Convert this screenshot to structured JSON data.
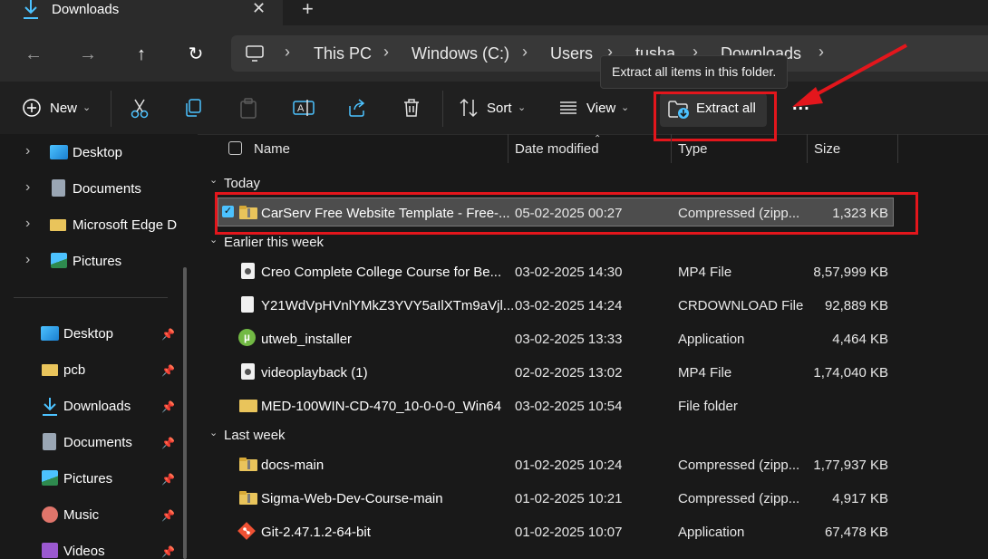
{
  "tab": {
    "title": "Downloads",
    "close_icon": "close-icon",
    "add_icon": "plus-icon"
  },
  "nav": {
    "breadcrumbs": [
      "This PC",
      "Windows (C:)",
      "Users",
      "tusha",
      "Downloads"
    ],
    "tooltip": "Extract all items in this folder."
  },
  "toolbar": {
    "new_label": "New",
    "sort_label": "Sort",
    "view_label": "View",
    "extract_label": "Extract all",
    "more_label": "..."
  },
  "sidebar": {
    "tree": [
      "Desktop",
      "Documents",
      "Microsoft Edge D",
      "Pictures"
    ],
    "quick": [
      "Desktop",
      "pcb",
      "Downloads",
      "Documents",
      "Pictures",
      "Music",
      "Videos"
    ]
  },
  "columns": {
    "name": "Name",
    "date": "Date modified",
    "type": "Type",
    "size": "Size"
  },
  "groups": [
    {
      "label": "Today",
      "rows": [
        {
          "name": "CarServ Free Website Template - Free-...",
          "date": "05-02-2025 00:27",
          "type": "Compressed (zipp...",
          "size": "1,323 KB",
          "icon": "zip-folder-icon"
        }
      ]
    },
    {
      "label": "Earlier this week",
      "rows": [
        {
          "name": "Creo Complete College Course for Be...",
          "date": "03-02-2025 14:30",
          "type": "MP4 File",
          "size": "8,57,999 KB",
          "icon": "video-file-icon"
        },
        {
          "name": "Y21WdVpHVnlYMkZ3YVY5aIlXTm9aVjl...",
          "date": "03-02-2025 14:24",
          "type": "CRDOWNLOAD File",
          "size": "92,889 KB",
          "icon": "file-icon"
        },
        {
          "name": "utweb_installer",
          "date": "03-02-2025 13:33",
          "type": "Application",
          "size": "4,464 KB",
          "icon": "utorrent-icon"
        },
        {
          "name": "videoplayback (1)",
          "date": "02-02-2025 13:02",
          "type": "MP4 File",
          "size": "1,74,040 KB",
          "icon": "video-file-icon"
        },
        {
          "name": "MED-100WIN-CD-470_10-0-0-0_Win64",
          "date": "03-02-2025 10:54",
          "type": "File folder",
          "size": "",
          "icon": "folder-icon"
        }
      ]
    },
    {
      "label": "Last week",
      "rows": [
        {
          "name": "docs-main",
          "date": "01-02-2025 10:24",
          "type": "Compressed (zipp...",
          "size": "1,77,937 KB",
          "icon": "zip-folder-icon"
        },
        {
          "name": "Sigma-Web-Dev-Course-main",
          "date": "01-02-2025 10:21",
          "type": "Compressed (zipp...",
          "size": "4,917 KB",
          "icon": "zip-folder-icon"
        },
        {
          "name": "Git-2.47.1.2-64-bit",
          "date": "01-02-2025 10:07",
          "type": "Application",
          "size": "67,478 KB",
          "icon": "git-icon"
        }
      ]
    }
  ],
  "colors": {
    "accent": "#4cc2ff",
    "highlight": "#e3161c",
    "folder": "#e9c45b"
  }
}
